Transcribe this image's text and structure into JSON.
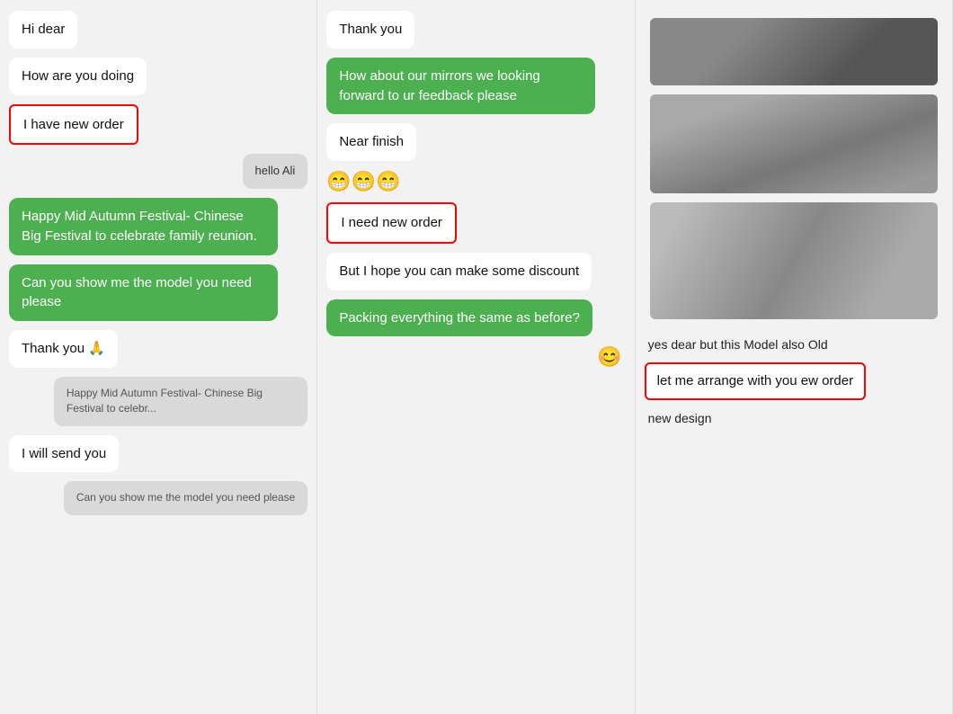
{
  "col1": {
    "messages": [
      {
        "id": "hi-dear",
        "text": "Hi dear",
        "type": "white",
        "align": "left",
        "outlined": false
      },
      {
        "id": "how-are-you",
        "text": "How are you doing",
        "type": "white",
        "align": "left",
        "outlined": false
      },
      {
        "id": "i-have-new-order",
        "text": "I have new order",
        "type": "white",
        "align": "left",
        "outlined": true
      },
      {
        "id": "hello-ali",
        "text": "hello Ali",
        "type": "gray",
        "align": "right",
        "outlined": false
      },
      {
        "id": "happy-festival",
        "text": "Happy Mid Autumn Festival- Chinese Big Festival to celebrate family reunion.",
        "type": "green",
        "align": "left",
        "outlined": false
      },
      {
        "id": "show-model",
        "text": "Can you show me the model you need please",
        "type": "green",
        "align": "left",
        "outlined": false
      },
      {
        "id": "thank-you-pray",
        "text": "Thank you 🙏",
        "type": "white",
        "align": "left",
        "outlined": false
      },
      {
        "id": "quote1",
        "text": "Happy Mid Autumn Festival- Chinese Big Festival to celebr...",
        "type": "gray-small",
        "align": "right",
        "outlined": false
      },
      {
        "id": "i-will-send",
        "text": "I will send you",
        "type": "white",
        "align": "left",
        "outlined": false
      },
      {
        "id": "quote2",
        "text": "Can you show me the model you need please",
        "type": "gray-small",
        "align": "right",
        "outlined": false
      }
    ]
  },
  "col2": {
    "messages": [
      {
        "id": "thank-you",
        "text": "Thank you",
        "type": "white",
        "align": "left",
        "outlined": false
      },
      {
        "id": "mirrors-feedback",
        "text": "How about our mirrors we looking forward to ur feedback please",
        "type": "green",
        "align": "left",
        "outlined": false
      },
      {
        "id": "near-finish",
        "text": "Near finish",
        "type": "white",
        "align": "left",
        "outlined": false
      },
      {
        "id": "emoji-laugh",
        "text": "😁😁😁",
        "type": "emoji",
        "align": "left",
        "outlined": false
      },
      {
        "id": "need-new-order",
        "text": "I need new order",
        "type": "white",
        "align": "left",
        "outlined": true
      },
      {
        "id": "discount",
        "text": "But I hope you can make some discount",
        "type": "white",
        "align": "left",
        "outlined": false
      },
      {
        "id": "packing",
        "text": "Packing everything the same as before?",
        "type": "green",
        "align": "left",
        "outlined": false
      }
    ],
    "footer_emoji": "😊"
  },
  "col3": {
    "images": [
      {
        "id": "img1",
        "class": "img1"
      },
      {
        "id": "img2",
        "class": "img2"
      },
      {
        "id": "img3",
        "class": "img3"
      }
    ],
    "messages": [
      {
        "id": "yes-dear",
        "text": "yes dear but this Model also Old",
        "type": "plain",
        "outlined": false
      },
      {
        "id": "arrange-order",
        "text": "let me arrange with you ew order",
        "type": "plain",
        "outlined": true
      },
      {
        "id": "new-design",
        "text": "new design",
        "type": "plain",
        "outlined": false
      }
    ]
  }
}
